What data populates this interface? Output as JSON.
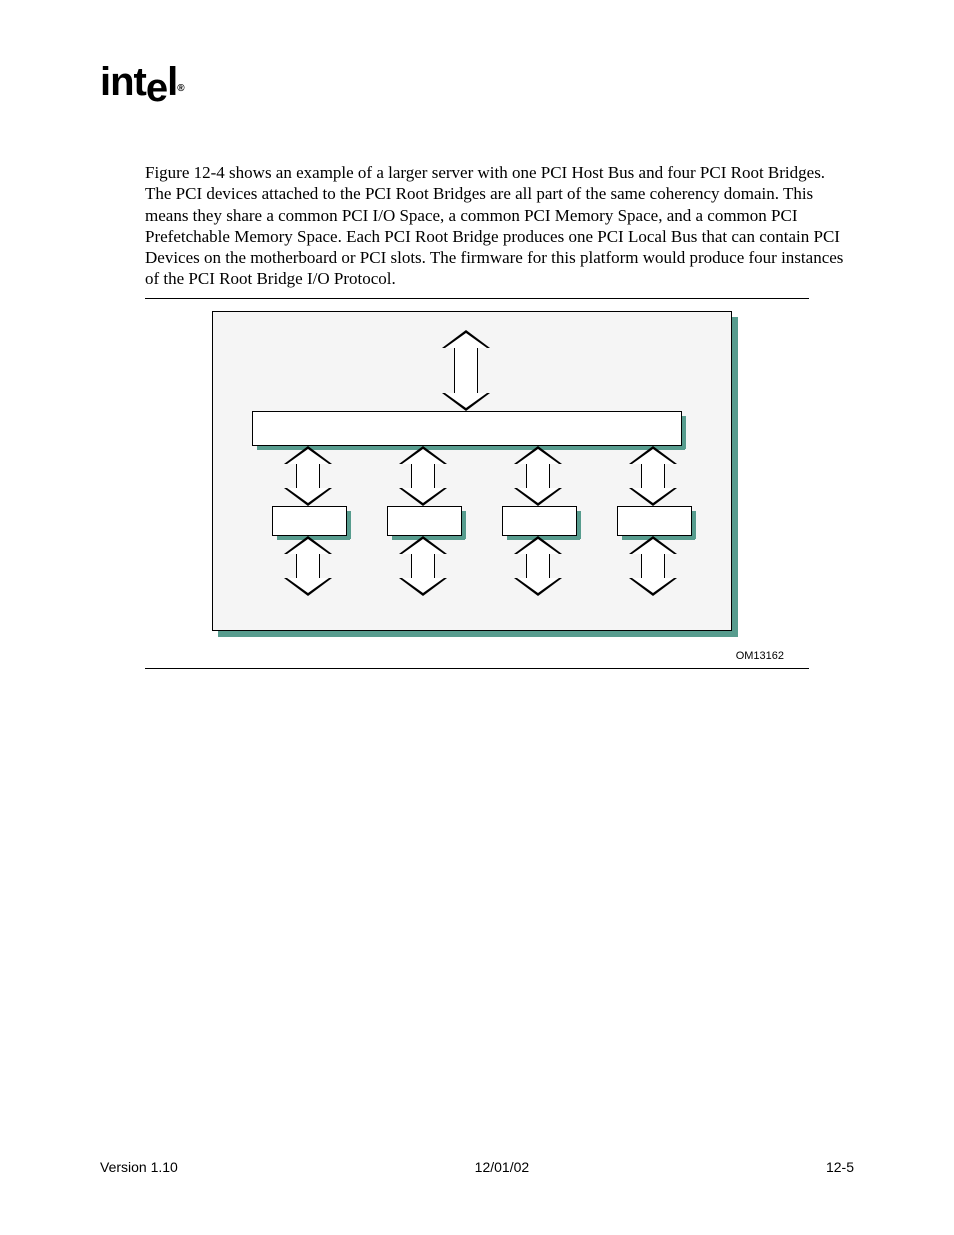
{
  "logo_text": "intel",
  "paragraph": "Figure 12-4 shows an example of a larger server with one PCI Host Bus and four PCI Root Bridges. The PCI devices attached to the PCI Root Bridges are all part of the same coherency domain.  This means they share a common PCI I/O Space, a common PCI Memory Space, and a common PCI Prefetchable Memory Space.  Each PCI Root Bridge produces one PCI Local Bus that can contain PCI Devices on the motherboard or PCI slots.  The firmware for this platform would produce four instances of the PCI Root Bridge I/O Protocol.",
  "figure_id": "OM13162",
  "footer": {
    "version": "Version 1.10",
    "date": "12/01/02",
    "page": "12-5"
  }
}
